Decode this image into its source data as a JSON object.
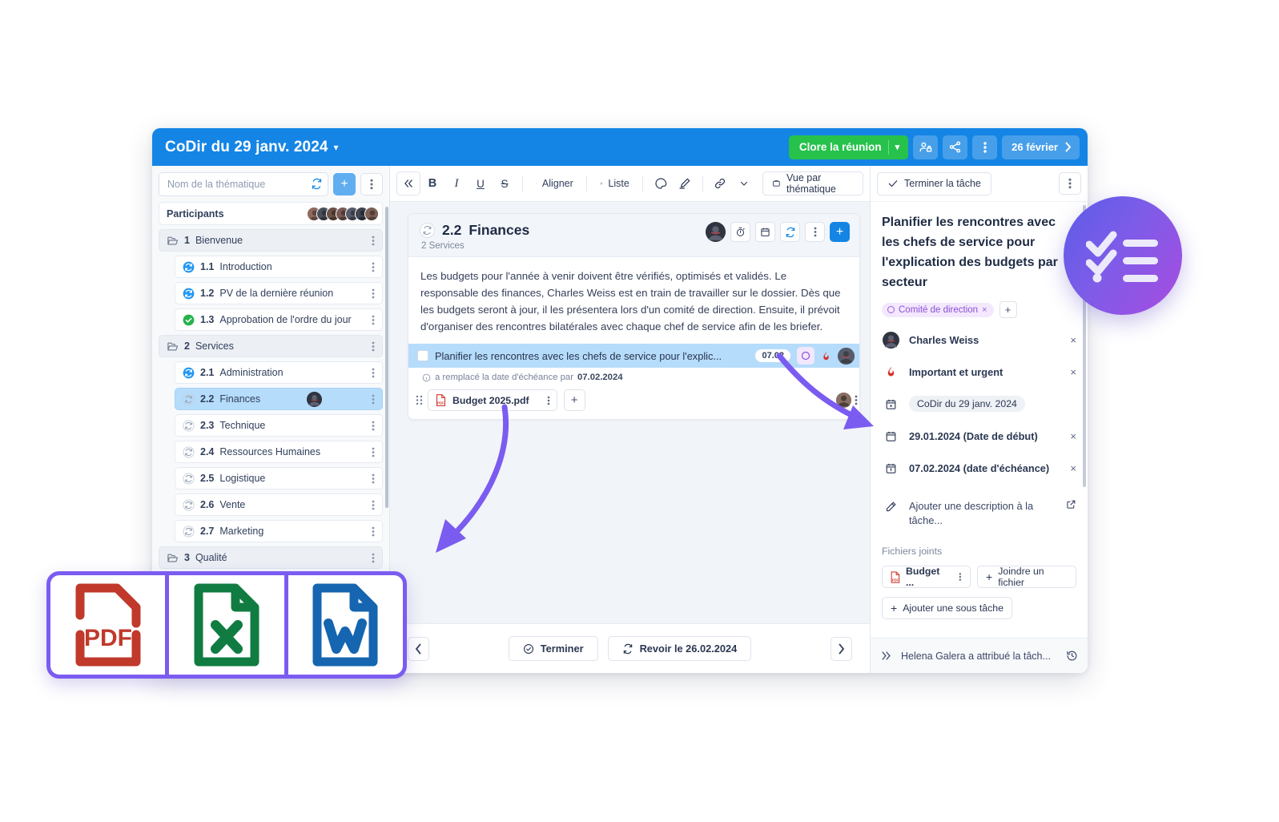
{
  "header": {
    "title": "CoDir du 29 janv. 2024",
    "caret_icon": "chevron-down-icon",
    "close_meeting_label": "Clore la réunion",
    "close_meeting_caret": "chevron-down-icon",
    "add_participant_icon": "user-lock-icon",
    "share_icon": "share-icon",
    "more_icon": "more-vertical-icon",
    "date_label": "26 février",
    "date_caret_icon": "chevron-right-icon"
  },
  "sidebar": {
    "search_placeholder": "Nom de la thématique",
    "refresh_icon": "refresh-icon",
    "add_label": "+",
    "more_icon": "more-vertical-icon",
    "participants_label": "Participants",
    "participants_count": 7,
    "items": [
      {
        "type": "folder",
        "num": "1",
        "label": "Bienvenue",
        "icon": "folder-icon",
        "selected": false
      },
      {
        "type": "child",
        "num": "1.1",
        "label": "Introduction",
        "icon": "recurring-blue-icon",
        "selected": false
      },
      {
        "type": "child",
        "num": "1.2",
        "label": "PV de la dernière réunion",
        "icon": "recurring-blue-icon",
        "selected": false
      },
      {
        "type": "child",
        "num": "1.3",
        "label": "Approbation de l'ordre du jour",
        "icon": "check-green-icon",
        "selected": false
      },
      {
        "type": "folder",
        "num": "2",
        "label": "Services",
        "icon": "folder-icon",
        "selected": false
      },
      {
        "type": "child",
        "num": "2.1",
        "label": "Administration",
        "icon": "recurring-blue-icon",
        "selected": false
      },
      {
        "type": "child",
        "num": "2.2",
        "label": "Finances",
        "icon": "recurring-grey-icon",
        "selected": true,
        "avatar": true
      },
      {
        "type": "child",
        "num": "2.3",
        "label": "Technique",
        "icon": "recurring-grey-icon",
        "selected": false
      },
      {
        "type": "child",
        "num": "2.4",
        "label": "Ressources Humaines",
        "icon": "recurring-grey-icon",
        "selected": false
      },
      {
        "type": "child",
        "num": "2.5",
        "label": "Logistique",
        "icon": "recurring-grey-icon",
        "selected": false
      },
      {
        "type": "child",
        "num": "2.6",
        "label": "Vente",
        "icon": "recurring-grey-icon",
        "selected": false
      },
      {
        "type": "child",
        "num": "2.7",
        "label": "Marketing",
        "icon": "recurring-grey-icon",
        "selected": false
      },
      {
        "type": "folder",
        "num": "3",
        "label": "Qualité",
        "icon": "folder-icon",
        "selected": false
      }
    ]
  },
  "toolbar": {
    "collapse_icon": "chevrons-left-icon",
    "bold_label": "B",
    "italic_label": "I",
    "underline_label": "U",
    "strike_label": "S",
    "align_label": "Aligner",
    "list_label": "Liste",
    "highlight_icon": "palette-icon",
    "pen_icon": "marker-icon",
    "link_icon": "link-icon",
    "more_caret_icon": "chevron-down-icon",
    "view_label": "Vue par thématique",
    "view_icon": "board-icon"
  },
  "right_toolbar": {
    "finish_task_label": "Terminer la tâche",
    "finish_task_icon": "check-icon",
    "more_icon": "more-vertical-icon"
  },
  "card": {
    "recurring_icon": "recurring-icon",
    "number": "2.2",
    "title": "Finances",
    "subtitle": "2 Services",
    "actions": {
      "avatar": "avatar-charles",
      "timer_icon": "timer-icon",
      "calendar_icon": "calendar-icon",
      "refresh_icon": "refresh-icon",
      "more_icon": "more-vertical-icon",
      "add_label": "+"
    },
    "paragraph": "Les budgets pour l'année à venir doivent être vérifiés, optimisés et validés. Le responsable des finances, Charles Weiss est en train de travailler sur le dossier. Dès que les budgets seront à jour, il les présentera lors d'un comité de direction. Ensuite, il prévoit d'organiser des rencontres bilatérales avec chaque chef de service afin de les briefer.",
    "task": {
      "text": "Planifier les rencontres avec les chefs de service pour l'explic...",
      "date_badge": "07.02",
      "status_icon": "circle-outline-icon",
      "priority_icon": "flame-icon",
      "assignee_avatar": "avatar-charles"
    },
    "meta": {
      "info_icon": "info-icon",
      "text": "a remplacé la date d'échéance par",
      "bold_value": "07.02.2024"
    },
    "attachments": {
      "add_icon": "plus-icon",
      "drag_icon": "drag-handle-icon",
      "file_name": "Budget 2025.pdf",
      "file_icon": "pdf-file-icon",
      "file_more_icon": "more-vertical-icon",
      "add_label": "+",
      "right_avatar": "avatar-small",
      "right_more_icon": "more-vertical-icon"
    }
  },
  "footer": {
    "prev_icon": "chevron-left-icon",
    "next_icon": "chevron-right-icon",
    "finish_label": "Terminer",
    "finish_icon": "check-circle-icon",
    "review_label": "Revoir le 26.02.2024",
    "review_icon": "recurring-icon"
  },
  "details": {
    "title": "Planifier les rencontres avec les chefs de service pour l'explication des budgets par secteur",
    "tag": {
      "label": "Comité de direction",
      "remove": "×",
      "color": "#8b4fd6"
    },
    "tag_add_label": "+",
    "assignee": {
      "label": "Charles Weiss",
      "icon": "avatar-charles",
      "remove": "×"
    },
    "priority": {
      "label": "Important et urgent",
      "icon": "flame-icon",
      "remove": "×"
    },
    "meeting": {
      "label": "CoDir du 29 janv. 2024",
      "icon": "calendar-star-icon"
    },
    "start_date": {
      "label": "29.01.2024  (Date de début)",
      "icon": "calendar-icon",
      "remove": "×"
    },
    "due_date": {
      "label": "07.02.2024  (date d'échéance)",
      "icon": "calendar-due-icon",
      "remove": "×"
    },
    "description_placeholder": "Ajouter une description à la tâche...",
    "description_icon": "pencil-icon",
    "description_open_icon": "external-link-icon",
    "attachments_label": "Fichiers joints",
    "attached_file": "Budget ...",
    "attached_file_icon": "pdf-file-icon",
    "attached_file_more_icon": "more-vertical-icon",
    "attach_button_label": "Joindre un fichier",
    "subtask_button_label": "Ajouter une sous tâche",
    "activity_text": "Helena Galera a attribué la tâch...",
    "activity_expand_icon": "chevrons-right-icon",
    "activity_history_icon": "history-icon"
  },
  "decorations": {
    "checklist_badge_icon": "checklist-badge-icon",
    "file_types": [
      {
        "name": "pdf-file-icon",
        "label": "PDF",
        "color": "#c0392b"
      },
      {
        "name": "excel-file-icon",
        "label": "X",
        "color": "#107c41"
      },
      {
        "name": "word-file-icon",
        "label": "W",
        "color": "#1565b0"
      }
    ],
    "arrow_color": "#7b5cf0"
  }
}
